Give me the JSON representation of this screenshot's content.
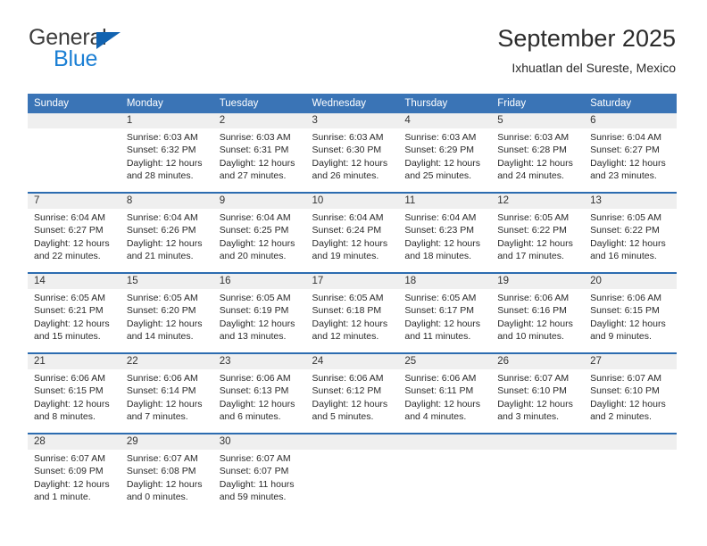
{
  "brand": {
    "name_top": "General",
    "name_bottom": "Blue",
    "triangle_color": "#1263b0",
    "blue_color": "#1b7fd4"
  },
  "header": {
    "title": "September 2025",
    "subtitle": "Ixhuatlan del Sureste, Mexico"
  },
  "colors": {
    "header_bg": "#3a74b6",
    "week_divider": "#2c6cb0",
    "daynum_bg": "#efefef",
    "text": "#2a2a2a"
  },
  "calendar": {
    "weekday_headers": [
      "Sunday",
      "Monday",
      "Tuesday",
      "Wednesday",
      "Thursday",
      "Friday",
      "Saturday"
    ],
    "weeks": [
      [
        {
          "day": "",
          "sunrise": "",
          "sunset": "",
          "daylight": "",
          "empty": true
        },
        {
          "day": "1",
          "sunrise": "Sunrise: 6:03 AM",
          "sunset": "Sunset: 6:32 PM",
          "daylight": "Daylight: 12 hours and 28 minutes."
        },
        {
          "day": "2",
          "sunrise": "Sunrise: 6:03 AM",
          "sunset": "Sunset: 6:31 PM",
          "daylight": "Daylight: 12 hours and 27 minutes."
        },
        {
          "day": "3",
          "sunrise": "Sunrise: 6:03 AM",
          "sunset": "Sunset: 6:30 PM",
          "daylight": "Daylight: 12 hours and 26 minutes."
        },
        {
          "day": "4",
          "sunrise": "Sunrise: 6:03 AM",
          "sunset": "Sunset: 6:29 PM",
          "daylight": "Daylight: 12 hours and 25 minutes."
        },
        {
          "day": "5",
          "sunrise": "Sunrise: 6:03 AM",
          "sunset": "Sunset: 6:28 PM",
          "daylight": "Daylight: 12 hours and 24 minutes."
        },
        {
          "day": "6",
          "sunrise": "Sunrise: 6:04 AM",
          "sunset": "Sunset: 6:27 PM",
          "daylight": "Daylight: 12 hours and 23 minutes."
        }
      ],
      [
        {
          "day": "7",
          "sunrise": "Sunrise: 6:04 AM",
          "sunset": "Sunset: 6:27 PM",
          "daylight": "Daylight: 12 hours and 22 minutes."
        },
        {
          "day": "8",
          "sunrise": "Sunrise: 6:04 AM",
          "sunset": "Sunset: 6:26 PM",
          "daylight": "Daylight: 12 hours and 21 minutes."
        },
        {
          "day": "9",
          "sunrise": "Sunrise: 6:04 AM",
          "sunset": "Sunset: 6:25 PM",
          "daylight": "Daylight: 12 hours and 20 minutes."
        },
        {
          "day": "10",
          "sunrise": "Sunrise: 6:04 AM",
          "sunset": "Sunset: 6:24 PM",
          "daylight": "Daylight: 12 hours and 19 minutes."
        },
        {
          "day": "11",
          "sunrise": "Sunrise: 6:04 AM",
          "sunset": "Sunset: 6:23 PM",
          "daylight": "Daylight: 12 hours and 18 minutes."
        },
        {
          "day": "12",
          "sunrise": "Sunrise: 6:05 AM",
          "sunset": "Sunset: 6:22 PM",
          "daylight": "Daylight: 12 hours and 17 minutes."
        },
        {
          "day": "13",
          "sunrise": "Sunrise: 6:05 AM",
          "sunset": "Sunset: 6:22 PM",
          "daylight": "Daylight: 12 hours and 16 minutes."
        }
      ],
      [
        {
          "day": "14",
          "sunrise": "Sunrise: 6:05 AM",
          "sunset": "Sunset: 6:21 PM",
          "daylight": "Daylight: 12 hours and 15 minutes."
        },
        {
          "day": "15",
          "sunrise": "Sunrise: 6:05 AM",
          "sunset": "Sunset: 6:20 PM",
          "daylight": "Daylight: 12 hours and 14 minutes."
        },
        {
          "day": "16",
          "sunrise": "Sunrise: 6:05 AM",
          "sunset": "Sunset: 6:19 PM",
          "daylight": "Daylight: 12 hours and 13 minutes."
        },
        {
          "day": "17",
          "sunrise": "Sunrise: 6:05 AM",
          "sunset": "Sunset: 6:18 PM",
          "daylight": "Daylight: 12 hours and 12 minutes."
        },
        {
          "day": "18",
          "sunrise": "Sunrise: 6:05 AM",
          "sunset": "Sunset: 6:17 PM",
          "daylight": "Daylight: 12 hours and 11 minutes."
        },
        {
          "day": "19",
          "sunrise": "Sunrise: 6:06 AM",
          "sunset": "Sunset: 6:16 PM",
          "daylight": "Daylight: 12 hours and 10 minutes."
        },
        {
          "day": "20",
          "sunrise": "Sunrise: 6:06 AM",
          "sunset": "Sunset: 6:15 PM",
          "daylight": "Daylight: 12 hours and 9 minutes."
        }
      ],
      [
        {
          "day": "21",
          "sunrise": "Sunrise: 6:06 AM",
          "sunset": "Sunset: 6:15 PM",
          "daylight": "Daylight: 12 hours and 8 minutes."
        },
        {
          "day": "22",
          "sunrise": "Sunrise: 6:06 AM",
          "sunset": "Sunset: 6:14 PM",
          "daylight": "Daylight: 12 hours and 7 minutes."
        },
        {
          "day": "23",
          "sunrise": "Sunrise: 6:06 AM",
          "sunset": "Sunset: 6:13 PM",
          "daylight": "Daylight: 12 hours and 6 minutes."
        },
        {
          "day": "24",
          "sunrise": "Sunrise: 6:06 AM",
          "sunset": "Sunset: 6:12 PM",
          "daylight": "Daylight: 12 hours and 5 minutes."
        },
        {
          "day": "25",
          "sunrise": "Sunrise: 6:06 AM",
          "sunset": "Sunset: 6:11 PM",
          "daylight": "Daylight: 12 hours and 4 minutes."
        },
        {
          "day": "26",
          "sunrise": "Sunrise: 6:07 AM",
          "sunset": "Sunset: 6:10 PM",
          "daylight": "Daylight: 12 hours and 3 minutes."
        },
        {
          "day": "27",
          "sunrise": "Sunrise: 6:07 AM",
          "sunset": "Sunset: 6:10 PM",
          "daylight": "Daylight: 12 hours and 2 minutes."
        }
      ],
      [
        {
          "day": "28",
          "sunrise": "Sunrise: 6:07 AM",
          "sunset": "Sunset: 6:09 PM",
          "daylight": "Daylight: 12 hours and 1 minute."
        },
        {
          "day": "29",
          "sunrise": "Sunrise: 6:07 AM",
          "sunset": "Sunset: 6:08 PM",
          "daylight": "Daylight: 12 hours and 0 minutes."
        },
        {
          "day": "30",
          "sunrise": "Sunrise: 6:07 AM",
          "sunset": "Sunset: 6:07 PM",
          "daylight": "Daylight: 11 hours and 59 minutes."
        },
        {
          "day": "",
          "sunrise": "",
          "sunset": "",
          "daylight": "",
          "empty": true
        },
        {
          "day": "",
          "sunrise": "",
          "sunset": "",
          "daylight": "",
          "empty": true
        },
        {
          "day": "",
          "sunrise": "",
          "sunset": "",
          "daylight": "",
          "empty": true
        },
        {
          "day": "",
          "sunrise": "",
          "sunset": "",
          "daylight": "",
          "empty": true
        }
      ]
    ]
  }
}
